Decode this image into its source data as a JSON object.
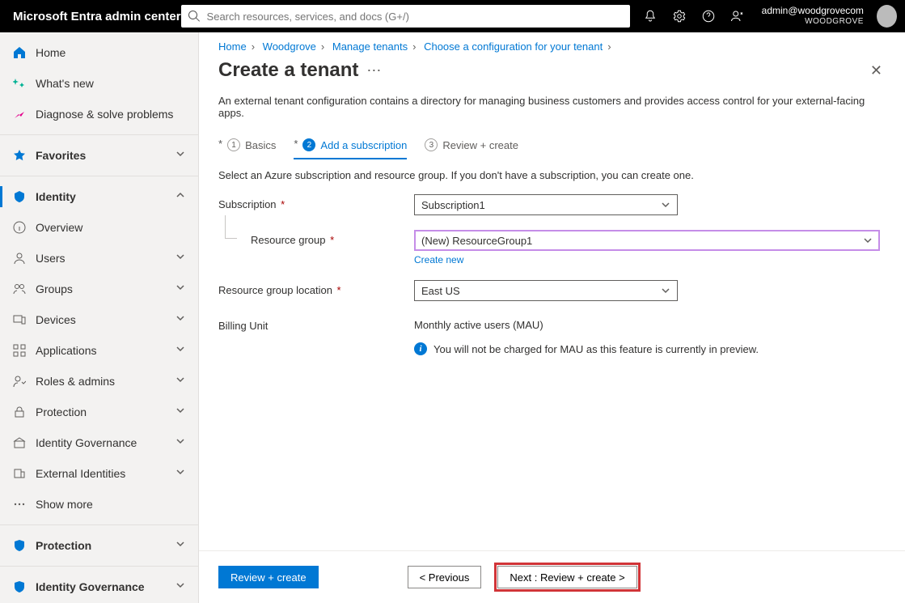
{
  "topbar": {
    "brand": "Microsoft Entra admin center",
    "search_placeholder": "Search resources, services, and docs (G+/)",
    "account_email": "admin@woodgrovecom",
    "account_org": "WOODGROVE"
  },
  "sidebar": {
    "home": "Home",
    "whatsnew": "What's new",
    "diagnose": "Diagnose & solve problems",
    "favorites": "Favorites",
    "identity": "Identity",
    "overview": "Overview",
    "users": "Users",
    "groups": "Groups",
    "devices": "Devices",
    "applications": "Applications",
    "roles": "Roles & admins",
    "protection_sub": "Protection",
    "governance_sub": "Identity Governance",
    "external": "External Identities",
    "showmore": "Show more",
    "protection": "Protection",
    "governance": "Identity Governance"
  },
  "breadcrumbs": [
    "Home",
    "Woodgrove",
    "Manage tenants",
    "Choose a configuration for your tenant"
  ],
  "page": {
    "title": "Create a tenant",
    "description": "An external tenant configuration contains a directory for managing business customers and provides access control for your external-facing apps.",
    "tabs": {
      "basics": "Basics",
      "add": "Add a subscription",
      "review": "Review + create"
    },
    "subdesc": "Select an Azure subscription and resource group. If you don't have a subscription, you can create one."
  },
  "form": {
    "subscription_label": "Subscription",
    "subscription_value": "Subscription1",
    "rg_label": "Resource group",
    "rg_value": "(New) ResourceGroup1",
    "create_new": "Create new",
    "rgl_label": "Resource group location",
    "rgl_value": "East US",
    "billing_label": "Billing Unit",
    "billing_value": "Monthly active users (MAU)",
    "billing_info": "You will not be charged for MAU as this feature is currently in preview."
  },
  "footer": {
    "review": "Review + create",
    "prev": "< Previous",
    "next": "Next : Review + create >"
  }
}
